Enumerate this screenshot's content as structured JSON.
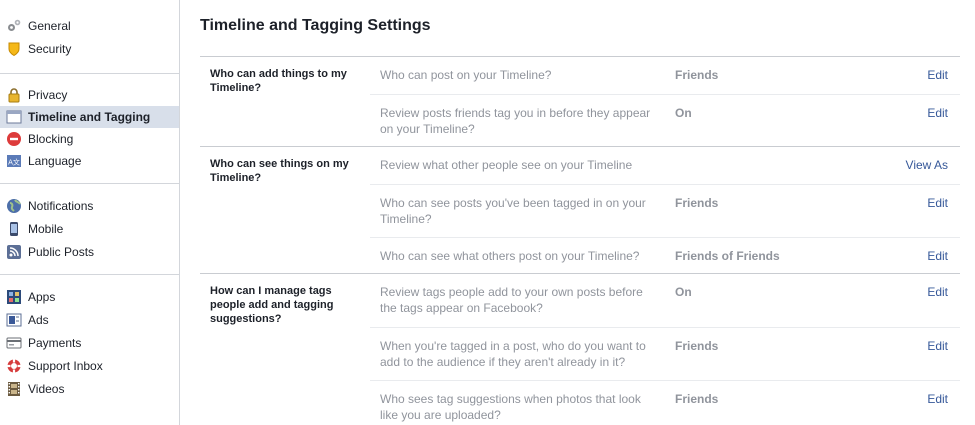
{
  "sidebar": {
    "groups": [
      {
        "items": [
          {
            "label": "General",
            "icon": "gears-icon"
          },
          {
            "label": "Security",
            "icon": "shield-icon"
          }
        ]
      },
      {
        "items": [
          {
            "label": "Privacy",
            "icon": "lock-icon"
          },
          {
            "label": "Timeline and Tagging",
            "icon": "timeline-icon",
            "active": true
          },
          {
            "label": "Blocking",
            "icon": "blocking-icon"
          },
          {
            "label": "Language",
            "icon": "language-icon"
          }
        ]
      },
      {
        "items": [
          {
            "label": "Notifications",
            "icon": "globe-icon"
          },
          {
            "label": "Mobile",
            "icon": "mobile-icon"
          },
          {
            "label": "Public Posts",
            "icon": "rss-icon"
          }
        ]
      },
      {
        "items": [
          {
            "label": "Apps",
            "icon": "apps-icon"
          },
          {
            "label": "Ads",
            "icon": "ads-icon"
          },
          {
            "label": "Payments",
            "icon": "credit-card-icon"
          },
          {
            "label": "Support Inbox",
            "icon": "lifebuoy-icon"
          },
          {
            "label": "Videos",
            "icon": "film-icon"
          }
        ]
      }
    ]
  },
  "main": {
    "title": "Timeline and Tagging Settings",
    "edit_label": "Edit",
    "sections": [
      {
        "heading": "Who can add things to my Timeline?",
        "rows": [
          {
            "question": "Who can post on your Timeline?",
            "value": "Friends",
            "action": "Edit"
          },
          {
            "question": "Review posts friends tag you in before they appear on your Timeline?",
            "value": "On",
            "action": "Edit"
          }
        ]
      },
      {
        "heading": "Who can see things on my Timeline?",
        "rows": [
          {
            "question": "Review what other people see on your Timeline",
            "value": "",
            "action": "View As"
          },
          {
            "question": "Who can see posts you've been tagged in on your Timeline?",
            "value": "Friends",
            "action": "Edit"
          },
          {
            "question": "Who can see what others post on your Timeline?",
            "value": "Friends of Friends",
            "action": "Edit"
          }
        ]
      },
      {
        "heading": "How can I manage tags people add and tagging suggestions?",
        "rows": [
          {
            "question": "Review tags people add to your own posts before the tags appear on Facebook?",
            "value": "On",
            "action": "Edit"
          },
          {
            "question": "When you're tagged in a post, who do you want to add to the audience if they aren't already in it?",
            "value": "Friends",
            "action": "Edit"
          },
          {
            "question": "Who sees tag suggestions when photos that look like you are uploaded?",
            "value": "Friends",
            "action": "Edit"
          }
        ]
      }
    ]
  },
  "colors": {
    "link": "#365899",
    "muted": "#90949c",
    "active_bg": "#d8dfea",
    "divider": "#c9ccd1"
  }
}
